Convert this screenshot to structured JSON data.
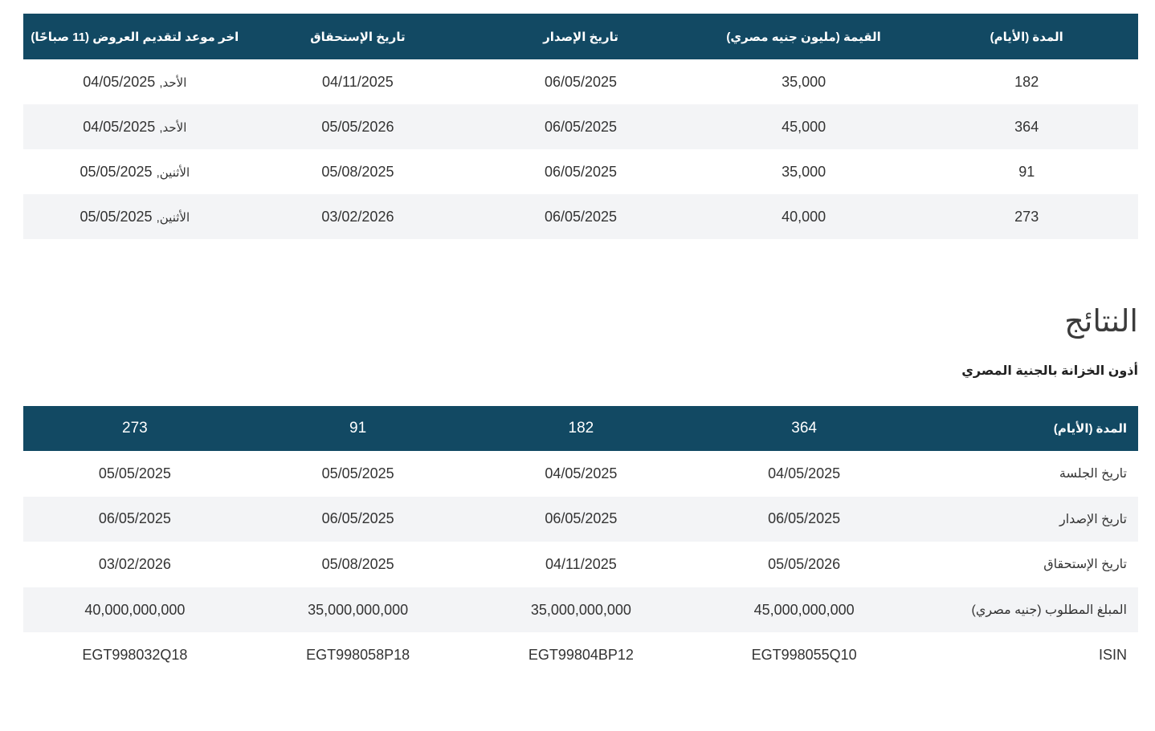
{
  "offerings": {
    "headers": [
      "المدة (الأيام)",
      "القيمة (مليون جنيه مصري)",
      "تاريخ الإصدار",
      "تاريخ الإستحقاق",
      "اخر موعد لتقديم العروض (11 صباحًا)"
    ],
    "rows": [
      {
        "duration": "182",
        "value": "35,000",
        "issue_date": "06/05/2025",
        "maturity_date": "04/11/2025",
        "deadline_day": "الأحد,",
        "deadline_date": "04/05/2025"
      },
      {
        "duration": "364",
        "value": "45,000",
        "issue_date": "06/05/2025",
        "maturity_date": "05/05/2026",
        "deadline_day": "الأحد,",
        "deadline_date": "04/05/2025"
      },
      {
        "duration": "91",
        "value": "35,000",
        "issue_date": "06/05/2025",
        "maturity_date": "05/08/2025",
        "deadline_day": "الأثنين,",
        "deadline_date": "05/05/2025"
      },
      {
        "duration": "273",
        "value": "40,000",
        "issue_date": "06/05/2025",
        "maturity_date": "03/02/2026",
        "deadline_day": "الأثنين,",
        "deadline_date": "05/05/2025"
      }
    ]
  },
  "results": {
    "title": "النتائج",
    "subtitle": "أذون الخزانة بالجنية المصري",
    "header_label": "المدة (الأيام)",
    "tenors": [
      "364",
      "182",
      "91",
      "273"
    ],
    "rows": [
      {
        "label": "تاريخ الجلسة",
        "values": [
          "04/05/2025",
          "04/05/2025",
          "05/05/2025",
          "05/05/2025"
        ]
      },
      {
        "label": "تاريخ الإصدار",
        "values": [
          "06/05/2025",
          "06/05/2025",
          "06/05/2025",
          "06/05/2025"
        ]
      },
      {
        "label": "تاريخ الإستحقاق",
        "values": [
          "05/05/2026",
          "04/11/2025",
          "05/08/2025",
          "03/02/2026"
        ]
      },
      {
        "label": "المبلغ المطلوب (جنيه مصري)",
        "values": [
          "45,000,000,000",
          "35,000,000,000",
          "35,000,000,000",
          "40,000,000,000"
        ]
      },
      {
        "label": "ISIN",
        "values": [
          "EGT998055Q10",
          "EGT99804BP12",
          "EGT998058P18",
          "EGT998032Q18"
        ]
      }
    ]
  },
  "colors": {
    "header_bg": "#124963",
    "stripe_bg": "#f3f4f6"
  }
}
